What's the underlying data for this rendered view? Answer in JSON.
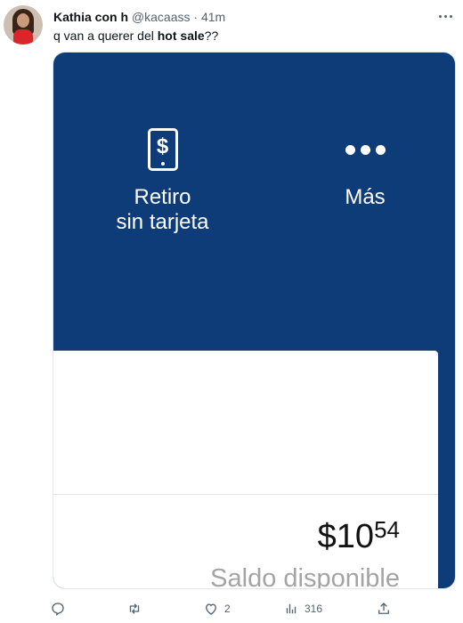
{
  "tweet": {
    "author_name": "Kathia con h",
    "handle": "@kacaass",
    "separator": "·",
    "time": "41m",
    "text_before": "q van a querer del ",
    "text_bold": "hot sale",
    "text_after": "??"
  },
  "media": {
    "action_left": {
      "line1": "Retiro",
      "line2": "sin tarjeta",
      "icon": "phone-dollar-icon"
    },
    "action_right": {
      "label": "Más",
      "icon": "three-dots-icon"
    },
    "balance": {
      "currency": "$",
      "integer": "10",
      "cents": "54",
      "label": "Saldo disponible"
    },
    "banner_color": "#0d3c78"
  },
  "engagement": {
    "reply_count": "",
    "retweet_count": "",
    "like_count": "2",
    "views_count": "316"
  }
}
